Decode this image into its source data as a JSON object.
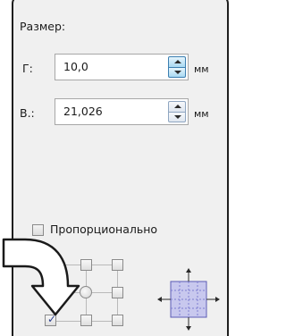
{
  "size_section": {
    "title": "Размер:"
  },
  "width_field": {
    "label": "Г:",
    "value": "10,0",
    "unit": "мм"
  },
  "height_field": {
    "label": "В.:",
    "value": "21,026",
    "unit": "мм"
  },
  "proportional": {
    "label": "Пропорционально",
    "checked": false
  },
  "anchor": {
    "selected": "bottom-left"
  },
  "colors": {
    "panel_bg": "#f0f0f0",
    "border": "#1e1e1e",
    "spinner_active": "#a9d9f2",
    "preview_accent": "#7e7ed0"
  }
}
